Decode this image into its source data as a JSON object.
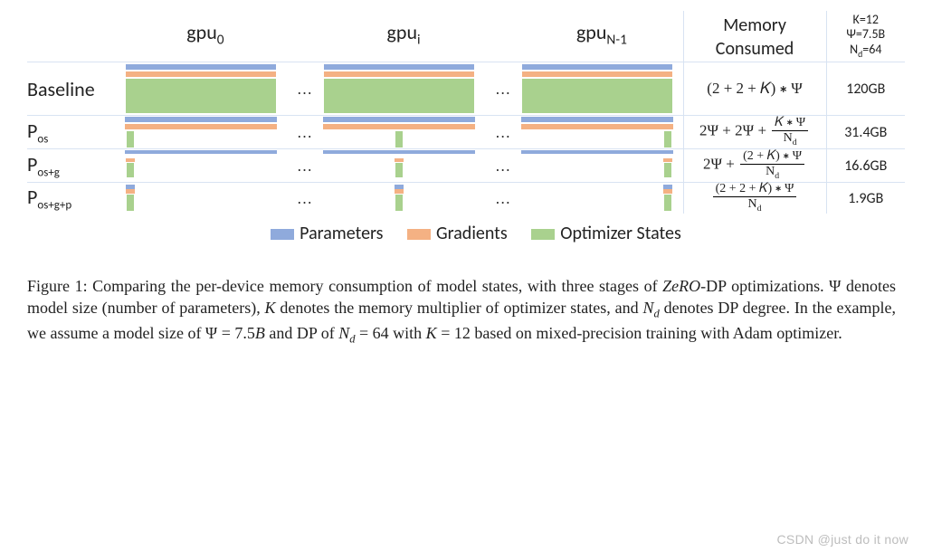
{
  "header": {
    "gpu0": "gpu",
    "gpu0_sub": "0",
    "gpui": "gpu",
    "gpui_sub": "i",
    "gpun": "gpu",
    "gpun_sub": "N-1",
    "mem_label": "Memory\nConsumed",
    "example": {
      "K": "K=12",
      "Psi": "Ψ=7.5B",
      "Nd": "N",
      "Nd_sub": "d",
      "Nd_val": "=64"
    }
  },
  "rows": [
    {
      "label": "Baseline",
      "formula_plain": "(2 + 2 + K) * Ψ",
      "mem": "120GB"
    },
    {
      "label_main": "P",
      "label_sub": "os",
      "formula_plain": "2Ψ + 2Ψ + (K*Ψ)/N_d",
      "mem": "31.4GB"
    },
    {
      "label_main": "P",
      "label_sub": "os+g",
      "formula_plain": "2Ψ + ((2+K)*Ψ)/N_d",
      "mem": "16.6GB"
    },
    {
      "label_main": "P",
      "label_sub": "os+g+p",
      "formula_plain": "((2+2+K)*Ψ)/N_d",
      "mem": "1.9GB"
    }
  ],
  "legend": {
    "params": "Parameters",
    "grads": "Gradients",
    "opt": "Optimizer States"
  },
  "caption": {
    "lead": "Figure 1:",
    "text_a": " Comparing the per-device memory consumption of model states, with three stages of ",
    "zero": "ZeRO",
    "text_b": "-DP optimizations. Ψ denotes model size (number of parameters), ",
    "K": "K",
    "text_c": " denotes the memory multiplier of optimizer states, and ",
    "Nd": "N",
    "Nd_sub": "d",
    "text_d": " denotes DP degree. In the example, we assume a model size of Ψ = 7.5",
    "B": "B",
    "text_e": " and DP of ",
    "text_f": " = 64 with ",
    "text_g": " = 12 based on mixed-precision training with Adam optimizer."
  },
  "watermark": "CSDN @just do it now",
  "misc": {
    "dots": "…"
  },
  "formulas": {
    "baseline": "(2 + 2 + 𝐾) ∗ Ψ",
    "pos_pre": "2Ψ + 2Ψ + ",
    "pos_num": "𝐾 ∗ Ψ",
    "pos_den": "N",
    "posg_pre": "2Ψ + ",
    "posg_num": "(2 + 𝐾) ∗ Ψ",
    "posgp_num": "(2 + 2 + 𝐾) ∗ Ψ",
    "den_sub": "d"
  },
  "chart_data": {
    "type": "bar",
    "title": "Per-device memory consumption across ZeRO-DP stages",
    "parameters": {
      "K": 12,
      "Psi_billion": 7.5,
      "N_d": 64
    },
    "components": [
      "Parameters",
      "Gradients",
      "Optimizer States"
    ],
    "categories": [
      "Baseline",
      "P_os",
      "P_os+g",
      "P_os+g+p"
    ],
    "gpu_columns": [
      "gpu_0",
      "gpu_i",
      "gpu_{N-1}"
    ],
    "formulas": [
      "(2 + 2 + K) * Ψ",
      "2Ψ + 2Ψ + (K*Ψ)/N_d",
      "2Ψ + ((2 + K)*Ψ)/N_d",
      "((2 + 2 + K)*Ψ)/N_d"
    ],
    "values_GB": [
      120,
      31.4,
      16.6,
      1.9
    ],
    "colors": {
      "Parameters": "#8faadc",
      "Gradients": "#f4b183",
      "Optimizer States": "#a9d18e"
    }
  }
}
